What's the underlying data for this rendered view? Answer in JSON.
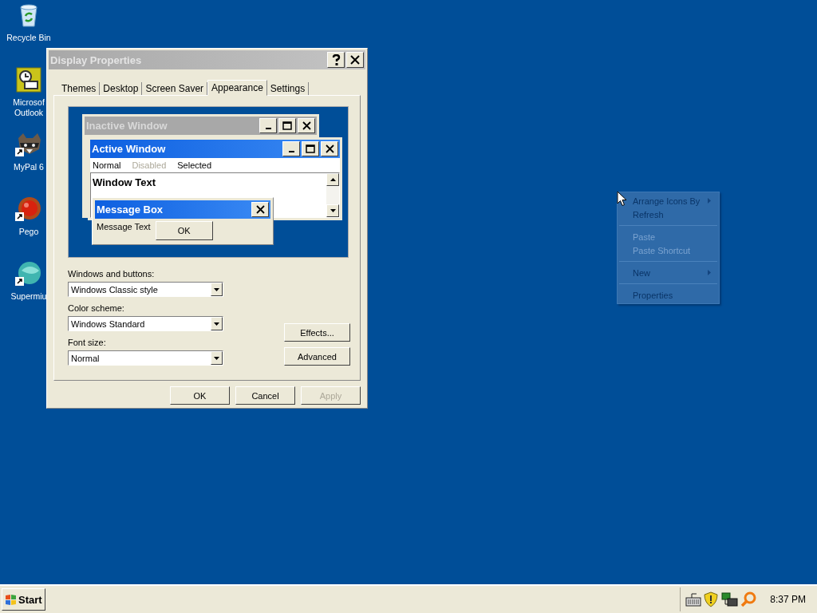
{
  "desktop_icons": [
    {
      "label": "Recycle Bin",
      "kind": "recycle"
    },
    {
      "label": "Microsof\nOutlook",
      "kind": "outlook"
    },
    {
      "label": "MyPal 6",
      "kind": "raccoon"
    },
    {
      "label": "Pego",
      "kind": "pego"
    },
    {
      "label": "Supermiu",
      "kind": "supermium"
    }
  ],
  "dialog": {
    "title": "Display Properties",
    "active": false,
    "tabs": [
      {
        "label": "Themes",
        "selected": false
      },
      {
        "label": "Desktop",
        "selected": false
      },
      {
        "label": "Screen Saver",
        "selected": false
      },
      {
        "label": "Appearance",
        "selected": true
      },
      {
        "label": "Settings",
        "selected": false
      }
    ],
    "preview": {
      "inactive_title": "Inactive Window",
      "active_title": "Active Window",
      "menu": [
        {
          "label": "Normal",
          "disabled": false
        },
        {
          "label": "Disabled",
          "disabled": true
        },
        {
          "label": "Selected",
          "disabled": false
        }
      ],
      "window_text": "Window Text",
      "message_title": "Message Box",
      "message_text": "Message Text",
      "message_button": "OK"
    },
    "fields": [
      {
        "label": "Windows and buttons:",
        "value": "Windows Classic style"
      },
      {
        "label": "Color scheme:",
        "value": "Windows Standard"
      },
      {
        "label": "Font size:",
        "value": "Normal"
      }
    ],
    "side_buttons": [
      "Effects...",
      "Advanced"
    ],
    "buttons": [
      {
        "label": "OK",
        "disabled": false
      },
      {
        "label": "Cancel",
        "disabled": false
      },
      {
        "label": "Apply",
        "disabled": true
      }
    ]
  },
  "context_menu": {
    "items": [
      {
        "kind": "item",
        "label": "Arrange Icons By",
        "submenu": true,
        "disabled": false
      },
      {
        "kind": "item",
        "label": "Refresh",
        "submenu": false,
        "disabled": false
      },
      {
        "kind": "separator"
      },
      {
        "kind": "item",
        "label": "Paste",
        "submenu": false,
        "disabled": true
      },
      {
        "kind": "item",
        "label": "Paste Shortcut",
        "submenu": false,
        "disabled": true
      },
      {
        "kind": "separator"
      },
      {
        "kind": "item",
        "label": "New",
        "submenu": true,
        "disabled": false
      },
      {
        "kind": "separator"
      },
      {
        "kind": "item",
        "label": "Properties",
        "submenu": false,
        "disabled": false
      }
    ]
  },
  "taskbar": {
    "start": "Start",
    "clock": "8:37 PM"
  }
}
